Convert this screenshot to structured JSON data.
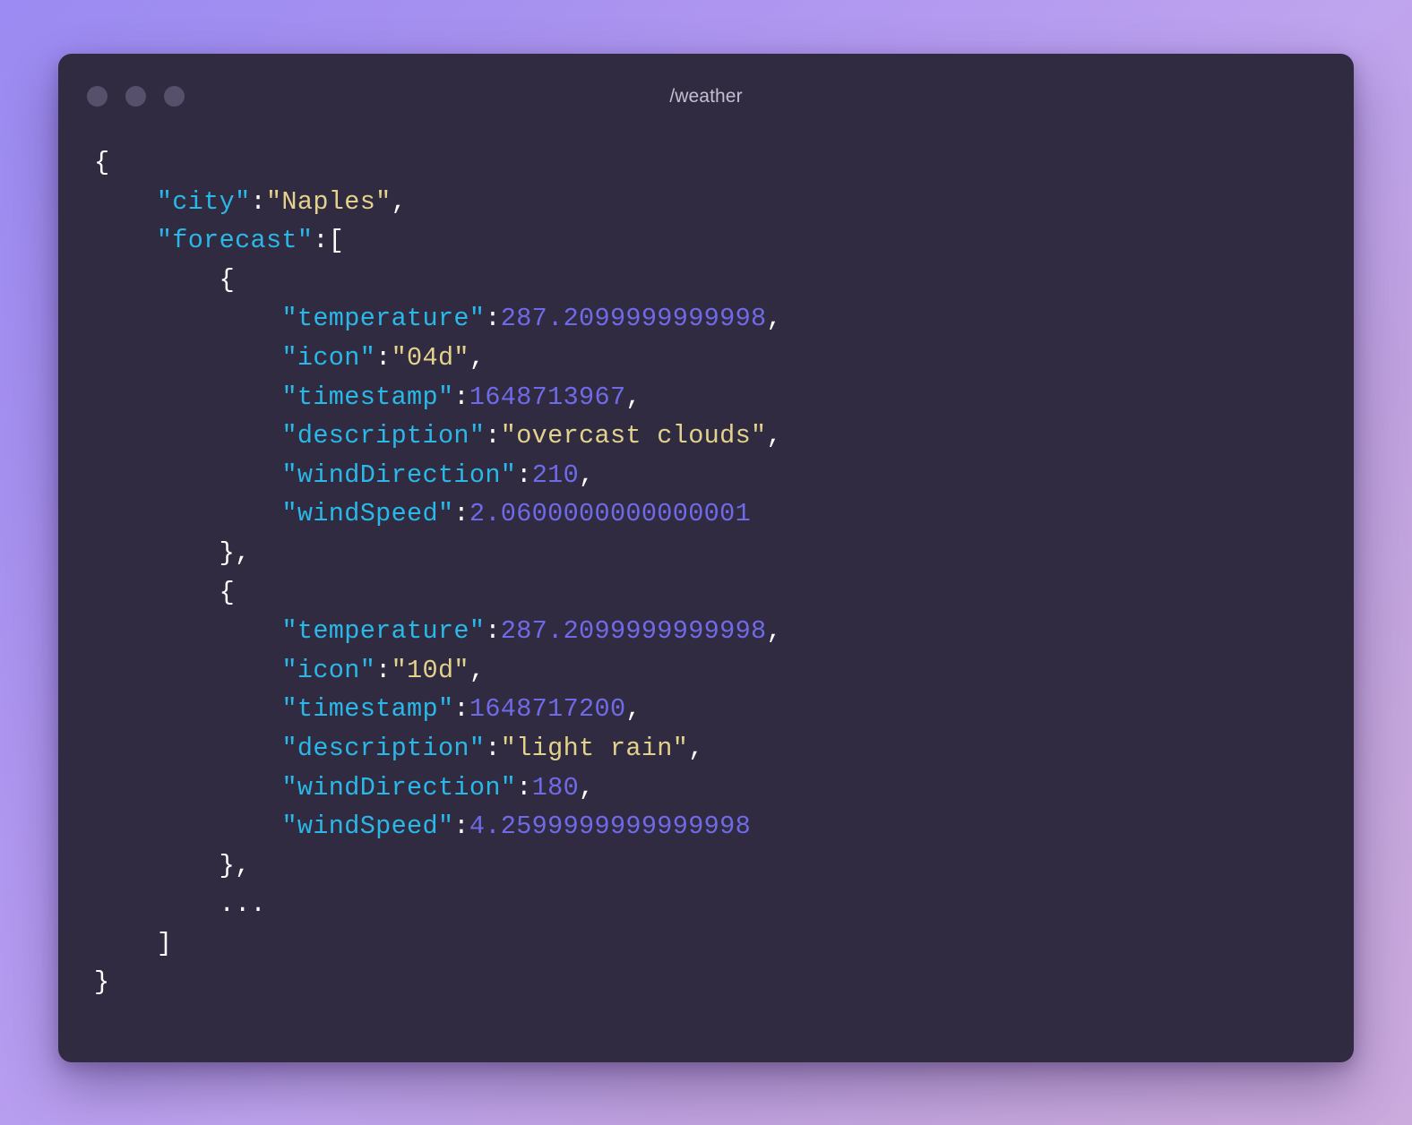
{
  "window": {
    "title": "/weather",
    "traffic_lights": [
      {
        "name": "close",
        "color": "#56506c"
      },
      {
        "name": "minimize",
        "color": "#56506c"
      },
      {
        "name": "maximize",
        "color": "#56506c"
      }
    ],
    "background_color": "#312b41"
  },
  "theme": {
    "desktop_gradient_start": "#9b8bf2",
    "desktop_gradient_end": "#cbaade",
    "key_color": "#29b8e8",
    "string_color": "#e3d28c",
    "number_color": "#6f6ae8",
    "punctuation_color": "#ffffff"
  },
  "code": {
    "language": "json",
    "lines": [
      {
        "indent": 0,
        "tokens": [
          {
            "t": "punc",
            "v": "{"
          }
        ]
      },
      {
        "indent": 1,
        "tokens": [
          {
            "t": "key",
            "v": "\"city\""
          },
          {
            "t": "punc",
            "v": ":"
          },
          {
            "t": "str",
            "v": "\"Naples\""
          },
          {
            "t": "punc",
            "v": ","
          }
        ]
      },
      {
        "indent": 1,
        "tokens": [
          {
            "t": "key",
            "v": "\"forecast\""
          },
          {
            "t": "punc",
            "v": ":["
          }
        ]
      },
      {
        "indent": 2,
        "tokens": [
          {
            "t": "punc",
            "v": "{"
          }
        ]
      },
      {
        "indent": 3,
        "tokens": [
          {
            "t": "key",
            "v": "\"temperature\""
          },
          {
            "t": "punc",
            "v": ":"
          },
          {
            "t": "num",
            "v": "287.2099999999998"
          },
          {
            "t": "punc",
            "v": ","
          }
        ]
      },
      {
        "indent": 3,
        "tokens": [
          {
            "t": "key",
            "v": "\"icon\""
          },
          {
            "t": "punc",
            "v": ":"
          },
          {
            "t": "str",
            "v": "\"04d\""
          },
          {
            "t": "punc",
            "v": ","
          }
        ]
      },
      {
        "indent": 3,
        "tokens": [
          {
            "t": "key",
            "v": "\"timestamp\""
          },
          {
            "t": "punc",
            "v": ":"
          },
          {
            "t": "num",
            "v": "1648713967"
          },
          {
            "t": "punc",
            "v": ","
          }
        ]
      },
      {
        "indent": 3,
        "tokens": [
          {
            "t": "key",
            "v": "\"description\""
          },
          {
            "t": "punc",
            "v": ":"
          },
          {
            "t": "str",
            "v": "\"overcast clouds\""
          },
          {
            "t": "punc",
            "v": ","
          }
        ]
      },
      {
        "indent": 3,
        "tokens": [
          {
            "t": "key",
            "v": "\"windDirection\""
          },
          {
            "t": "punc",
            "v": ":"
          },
          {
            "t": "num",
            "v": "210"
          },
          {
            "t": "punc",
            "v": ","
          }
        ]
      },
      {
        "indent": 3,
        "tokens": [
          {
            "t": "key",
            "v": "\"windSpeed\""
          },
          {
            "t": "punc",
            "v": ":"
          },
          {
            "t": "num",
            "v": "2.0600000000000001"
          }
        ]
      },
      {
        "indent": 2,
        "tokens": [
          {
            "t": "punc",
            "v": "},"
          }
        ]
      },
      {
        "indent": 2,
        "tokens": [
          {
            "t": "punc",
            "v": "{"
          }
        ]
      },
      {
        "indent": 3,
        "tokens": [
          {
            "t": "key",
            "v": "\"temperature\""
          },
          {
            "t": "punc",
            "v": ":"
          },
          {
            "t": "num",
            "v": "287.2099999999998"
          },
          {
            "t": "punc",
            "v": ","
          }
        ]
      },
      {
        "indent": 3,
        "tokens": [
          {
            "t": "key",
            "v": "\"icon\""
          },
          {
            "t": "punc",
            "v": ":"
          },
          {
            "t": "str",
            "v": "\"10d\""
          },
          {
            "t": "punc",
            "v": ","
          }
        ]
      },
      {
        "indent": 3,
        "tokens": [
          {
            "t": "key",
            "v": "\"timestamp\""
          },
          {
            "t": "punc",
            "v": ":"
          },
          {
            "t": "num",
            "v": "1648717200"
          },
          {
            "t": "punc",
            "v": ","
          }
        ]
      },
      {
        "indent": 3,
        "tokens": [
          {
            "t": "key",
            "v": "\"description\""
          },
          {
            "t": "punc",
            "v": ":"
          },
          {
            "t": "str",
            "v": "\"light rain\""
          },
          {
            "t": "punc",
            "v": ","
          }
        ]
      },
      {
        "indent": 3,
        "tokens": [
          {
            "t": "key",
            "v": "\"windDirection\""
          },
          {
            "t": "punc",
            "v": ":"
          },
          {
            "t": "num",
            "v": "180"
          },
          {
            "t": "punc",
            "v": ","
          }
        ]
      },
      {
        "indent": 3,
        "tokens": [
          {
            "t": "key",
            "v": "\"windSpeed\""
          },
          {
            "t": "punc",
            "v": ":"
          },
          {
            "t": "num",
            "v": "4.2599999999999998"
          }
        ]
      },
      {
        "indent": 2,
        "tokens": [
          {
            "t": "punc",
            "v": "},"
          }
        ]
      },
      {
        "indent": 2,
        "tokens": [
          {
            "t": "dots",
            "v": "..."
          }
        ]
      },
      {
        "indent": 1,
        "tokens": [
          {
            "t": "punc",
            "v": "]"
          }
        ]
      },
      {
        "indent": 0,
        "tokens": [
          {
            "t": "punc",
            "v": "}"
          }
        ]
      }
    ]
  }
}
